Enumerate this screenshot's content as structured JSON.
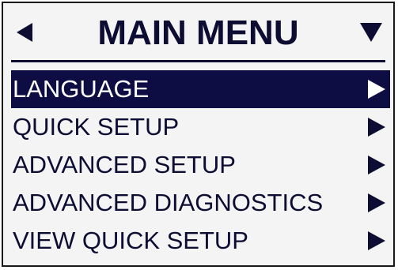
{
  "header": {
    "title": "MAIN MENU",
    "left_icon": "triangle-left-icon",
    "right_icon": "triangle-down-icon"
  },
  "menu": {
    "items": [
      {
        "label": "LANGUAGE",
        "selected": true,
        "icon": "triangle-right-icon"
      },
      {
        "label": "QUICK SETUP",
        "selected": false,
        "icon": "triangle-right-icon"
      },
      {
        "label": "ADVANCED SETUP",
        "selected": false,
        "icon": "triangle-right-icon"
      },
      {
        "label": "ADVANCED DIAGNOSTICS",
        "selected": false,
        "icon": "triangle-right-icon"
      },
      {
        "label": "VIEW QUICK SETUP",
        "selected": false,
        "icon": "triangle-right-icon"
      }
    ]
  },
  "colors": {
    "text": "#0d0d33",
    "highlight_bg": "#0d0d44",
    "highlight_text": "#ffffff",
    "screen_bg": "#f4f4f4"
  }
}
